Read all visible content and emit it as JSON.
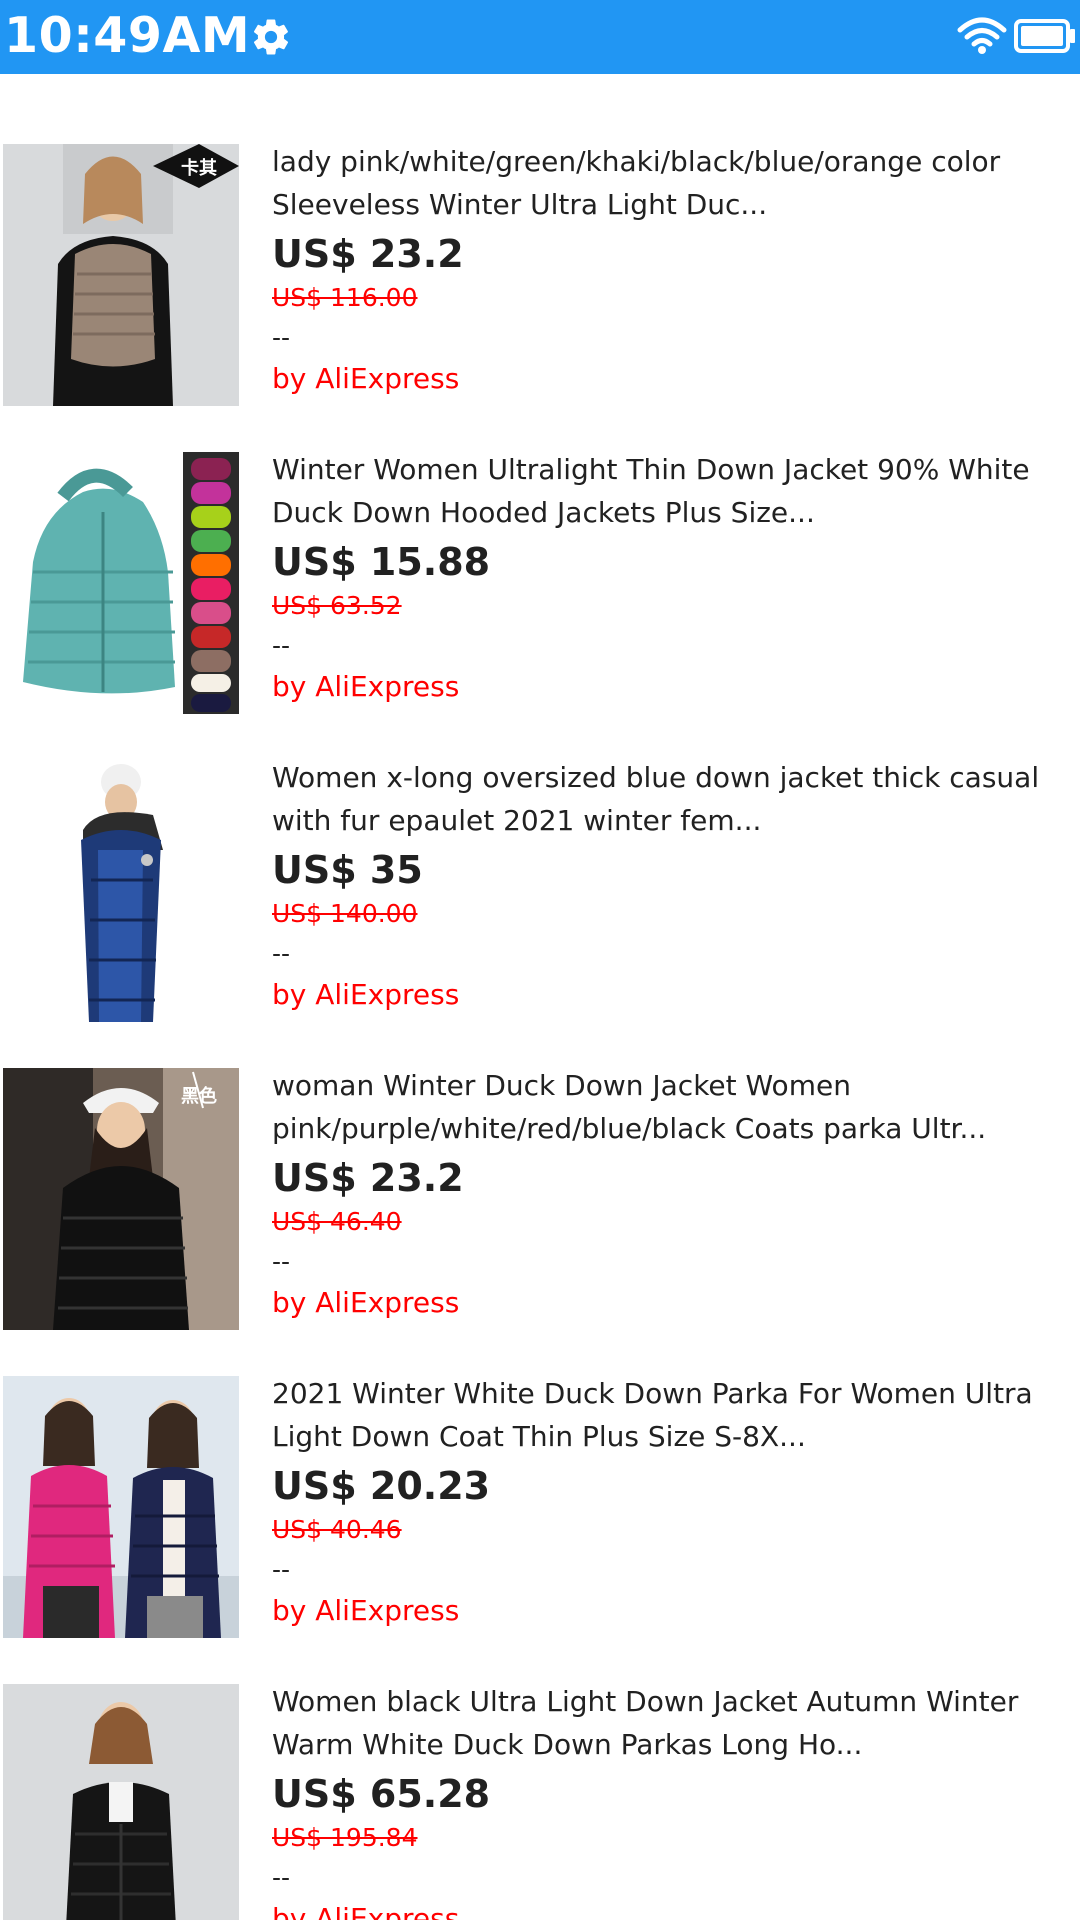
{
  "status_bar": {
    "time": "10:49AM",
    "color": "#2196F3"
  },
  "products": [
    {
      "title": "lady pink/white/green/khaki/black/blue/orange color Sleeveless Winter Ultra Light Duc...",
      "price": "US$ 23.2",
      "original_price": "US$ 116.00",
      "rating": "--",
      "seller": "by AliExpress",
      "image_label": "卡其"
    },
    {
      "title": "Winter Women Ultralight Thin Down Jacket 90% White Duck Down Hooded Jackets Plus Size...",
      "price": "US$ 15.88",
      "original_price": "US$ 63.52",
      "rating": "--",
      "seller": "by AliExpress"
    },
    {
      "title": "Women x-long oversized blue down jacket thick casual with fur epaulet 2021 winter fem...",
      "price": "US$ 35",
      "original_price": "US$ 140.00",
      "rating": "--",
      "seller": "by AliExpress"
    },
    {
      "title": "woman Winter Duck Down Jacket Women pink/purple/white/red/blue/black Coats parka Ultr...",
      "price": "US$ 23.2",
      "original_price": "US$ 46.40",
      "rating": "--",
      "seller": "by AliExpress",
      "image_label": "黑色"
    },
    {
      "title": "2021 Winter White Duck Down Parka For Women Ultra Light Down Coat Thin Plus Size S-8X...",
      "price": "US$ 20.23",
      "original_price": "US$ 40.46",
      "rating": "--",
      "seller": "by AliExpress"
    },
    {
      "title": "Women black Ultra Light Down Jacket Autumn Winter Warm White Duck Down Parkas Long Ho...",
      "price": "US$ 65.28",
      "original_price": "US$ 195.84",
      "rating": "--",
      "seller": "by AliExpress"
    }
  ]
}
